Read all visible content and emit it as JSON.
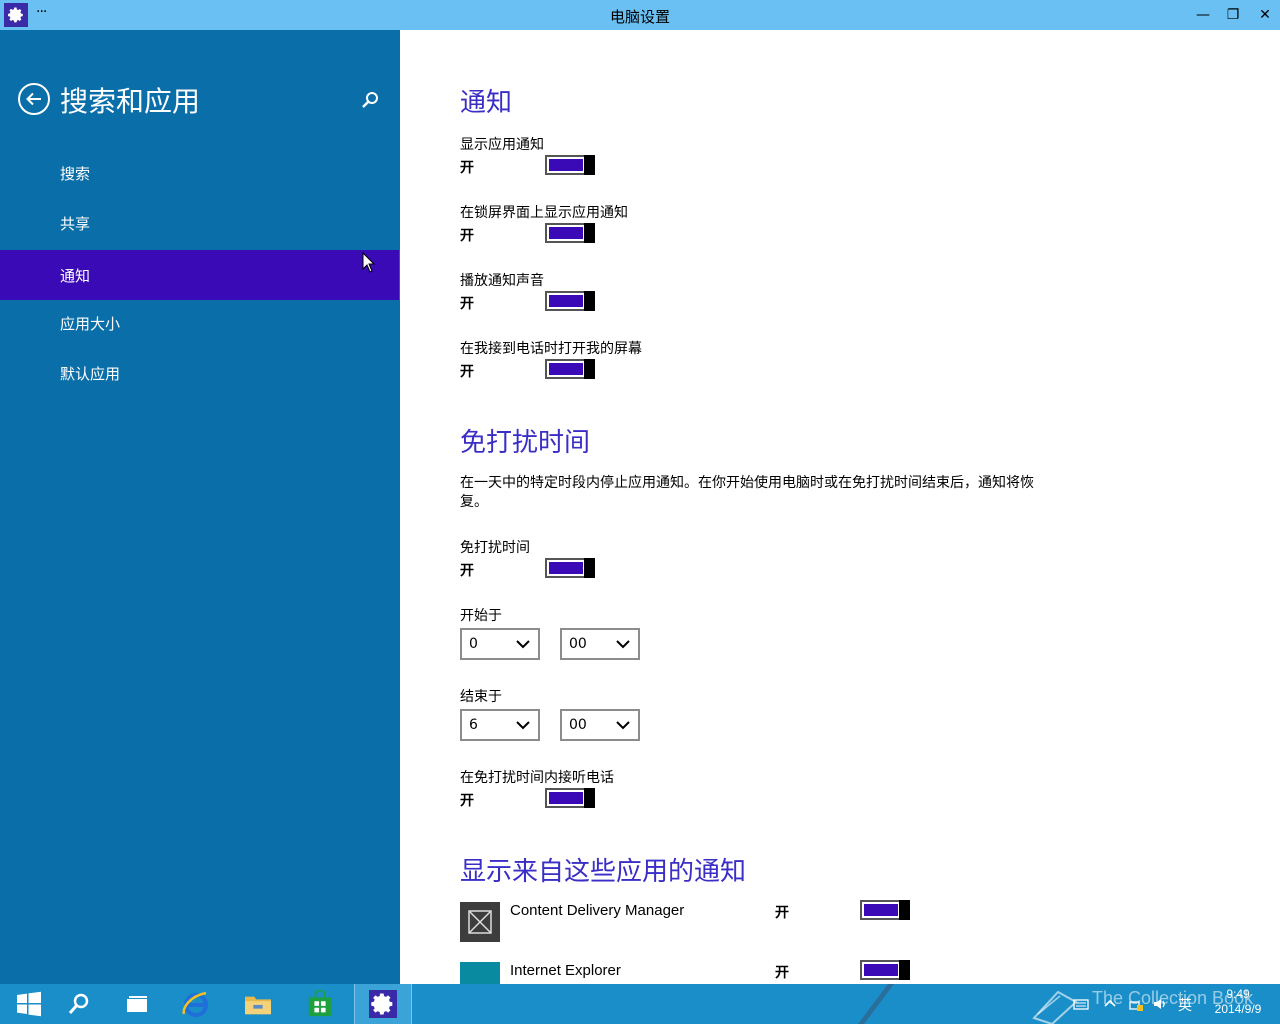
{
  "window": {
    "title": "电脑设置",
    "menu_dots": "···",
    "minimize_glyph": "—",
    "maximize_glyph": "❐",
    "close_glyph": "✕"
  },
  "sidebar": {
    "title": "搜索和应用",
    "items": [
      {
        "label": "搜索",
        "active": false
      },
      {
        "label": "共享",
        "active": false
      },
      {
        "label": "通知",
        "active": true
      },
      {
        "label": "应用大小",
        "active": false
      },
      {
        "label": "默认应用",
        "active": false
      }
    ]
  },
  "content": {
    "notifications": {
      "title": "通知",
      "settings": [
        {
          "label": "显示应用通知",
          "state": "开",
          "on": true
        },
        {
          "label": "在锁屏界面上显示应用通知",
          "state": "开",
          "on": true
        },
        {
          "label": "播放通知声音",
          "state": "开",
          "on": true
        },
        {
          "label": "在我接到电话时打开我的屏幕",
          "state": "开",
          "on": true
        }
      ]
    },
    "quiet_hours": {
      "title": "免打扰时间",
      "description": "在一天中的特定时段内停止应用通知。在你开始使用电脑时或在免打扰时间结束后，通知将恢复。",
      "toggle": {
        "label": "免打扰时间",
        "state": "开",
        "on": true
      },
      "start": {
        "label": "开始于",
        "hour": "0",
        "minute": "00"
      },
      "end": {
        "label": "结束于",
        "hour": "6",
        "minute": "00"
      },
      "calls": {
        "label": "在免打扰时间内接听电话",
        "state": "开",
        "on": true
      }
    },
    "apps": {
      "title": "显示来自这些应用的通知",
      "items": [
        {
          "name": "Content Delivery Manager",
          "state": "开",
          "on": true,
          "icon_color": "#3d3d3d"
        },
        {
          "name": "Internet Explorer",
          "state": "开",
          "on": true,
          "icon_color": "#0a8aa0"
        }
      ]
    }
  },
  "taskbar": {
    "clock_time": "9:49",
    "clock_date": "2014/9/9",
    "ime": "英",
    "watermark": "The Collection Book"
  },
  "colors": {
    "accent": "#3a0ab6",
    "sidebar": "#0a6ea8",
    "heading": "#3a2ec6",
    "titlebar": "#6ac0f2",
    "taskbar": "#1a8ec8"
  }
}
